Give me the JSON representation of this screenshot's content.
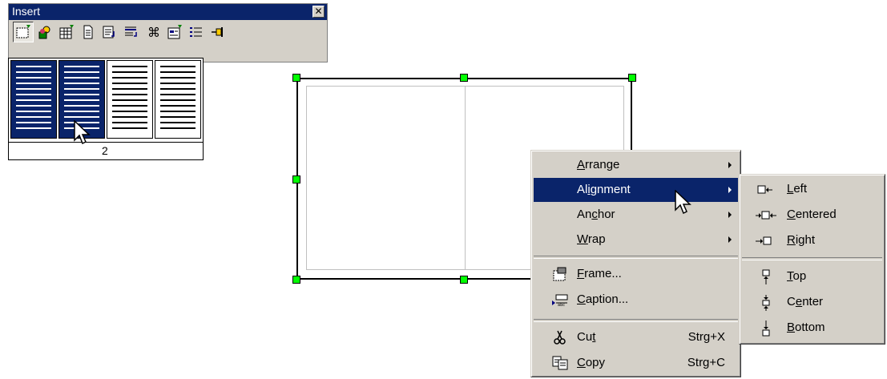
{
  "toolbar": {
    "title": "Insert",
    "close_glyph": "✕",
    "buttons": [
      {
        "icon": "insert-frame-icon"
      },
      {
        "icon": "insert-picture-icon"
      },
      {
        "icon": "insert-table-icon"
      },
      {
        "icon": "insert-document-icon"
      },
      {
        "icon": "insert-field-icon"
      },
      {
        "icon": "insert-section-icon"
      },
      {
        "icon": "insert-special-character-icon"
      },
      {
        "icon": "insert-form-icon"
      },
      {
        "icon": "insert-index-icon"
      },
      {
        "icon": "insert-pin-icon"
      }
    ]
  },
  "column_picker": {
    "selected_count": "2",
    "total_columns": 4,
    "selected_columns": 2
  },
  "context_menu": {
    "items": [
      {
        "label": "Arrange",
        "accel": "A",
        "has_submenu": true
      },
      {
        "label": "Alignment",
        "accel": "i",
        "has_submenu": true,
        "highlighted": true
      },
      {
        "label": "Anchor",
        "accel": "c",
        "has_submenu": true
      },
      {
        "label": "Wrap",
        "accel": "W",
        "has_submenu": true
      },
      {
        "label": "Frame...",
        "accel": "F",
        "icon": "frame-icon"
      },
      {
        "label": "Caption...",
        "accel": "C",
        "icon": "caption-icon"
      },
      {
        "label": "Cut",
        "accel": "t",
        "shortcut": "Strg+X",
        "icon": "scissors-icon"
      },
      {
        "label": "Copy",
        "accel": "C",
        "shortcut": "Strg+C",
        "icon": "copy-icon"
      }
    ]
  },
  "alignment_submenu": {
    "items": [
      {
        "label": "Left",
        "icon": "align-left-icon"
      },
      {
        "label": "Centered",
        "icon": "align-center-icon"
      },
      {
        "label": "Right",
        "icon": "align-right-icon"
      },
      {
        "label": "Top",
        "icon": "align-top-icon"
      },
      {
        "label": "Center",
        "icon": "align-vcenter-icon"
      },
      {
        "label": "Bottom",
        "icon": "align-bottom-icon"
      }
    ]
  },
  "colors": {
    "highlight": "#0a246a",
    "menu_bg": "#d4d0c8",
    "handle": "#00ff00"
  }
}
